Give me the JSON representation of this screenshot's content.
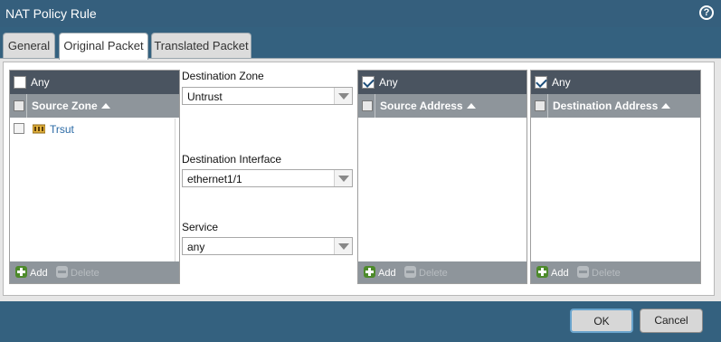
{
  "window": {
    "title": "NAT Policy Rule",
    "help_icon": "?"
  },
  "tabs": [
    {
      "label": "General",
      "active": false
    },
    {
      "label": "Original Packet",
      "active": true
    },
    {
      "label": "Translated Packet",
      "active": false
    }
  ],
  "source_zone": {
    "any_label": "Any",
    "any_checked": false,
    "column_header": "Source Zone",
    "rows": [
      {
        "name": "Trsut",
        "icon": "zone-icon"
      }
    ],
    "add_label": "Add",
    "delete_label": "Delete"
  },
  "destination": {
    "zone_label": "Destination Zone",
    "zone_value": "Untrust",
    "interface_label": "Destination Interface",
    "interface_value": "ethernet1/1",
    "service_label": "Service",
    "service_value": "any"
  },
  "source_address": {
    "any_label": "Any",
    "any_checked": true,
    "column_header": "Source Address",
    "add_label": "Add",
    "delete_label": "Delete"
  },
  "destination_address": {
    "any_label": "Any",
    "any_checked": true,
    "column_header": "Destination Address",
    "add_label": "Add",
    "delete_label": "Delete"
  },
  "buttons": {
    "ok": "OK",
    "cancel": "Cancel"
  },
  "colors": {
    "titlebar": "#355f7d",
    "accent_link": "#2a6aa5",
    "add_green": "#4d8a2b"
  }
}
